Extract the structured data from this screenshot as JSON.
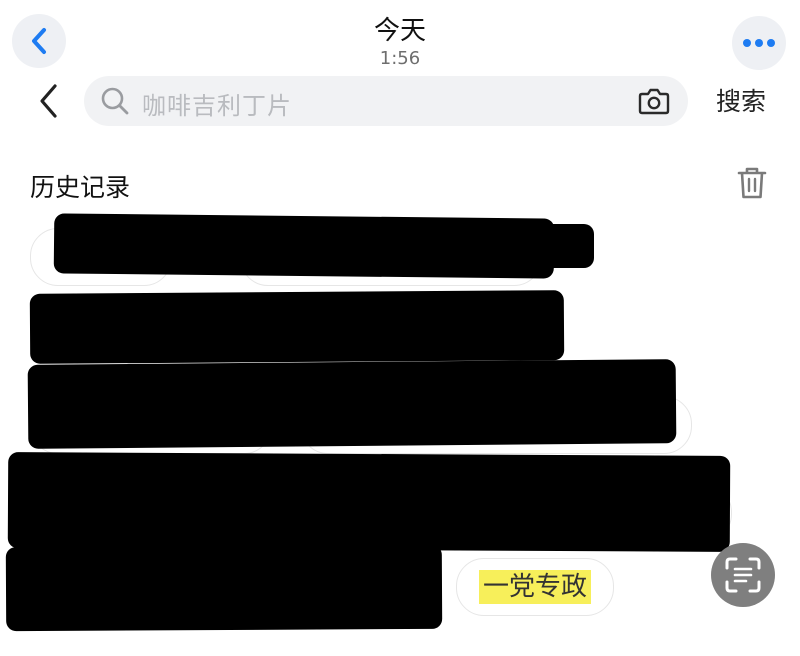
{
  "header": {
    "title": "今天",
    "subtitle": "1:56"
  },
  "search": {
    "placeholder": "咖啡吉利丁片",
    "button_label": "搜索"
  },
  "history": {
    "title": "历史记录",
    "items": [
      {
        "label": "",
        "redacted": true
      },
      {
        "label": "",
        "redacted": true
      },
      {
        "label": "",
        "redacted": true
      },
      {
        "label": "",
        "redacted": true
      },
      {
        "label": "",
        "redacted": true
      },
      {
        "label": "一党专政",
        "redacted": false,
        "highlight": "#f7ef5a"
      }
    ]
  },
  "icons": {
    "back": "chevron-left-icon",
    "more": "more-horizontal-icon",
    "search": "search-icon",
    "camera": "camera-icon",
    "trash": "trash-icon",
    "scan": "scan-text-icon"
  },
  "colors": {
    "accent": "#1e7cf2",
    "highlight": "#f7ef5a",
    "redaction": "#000000"
  }
}
